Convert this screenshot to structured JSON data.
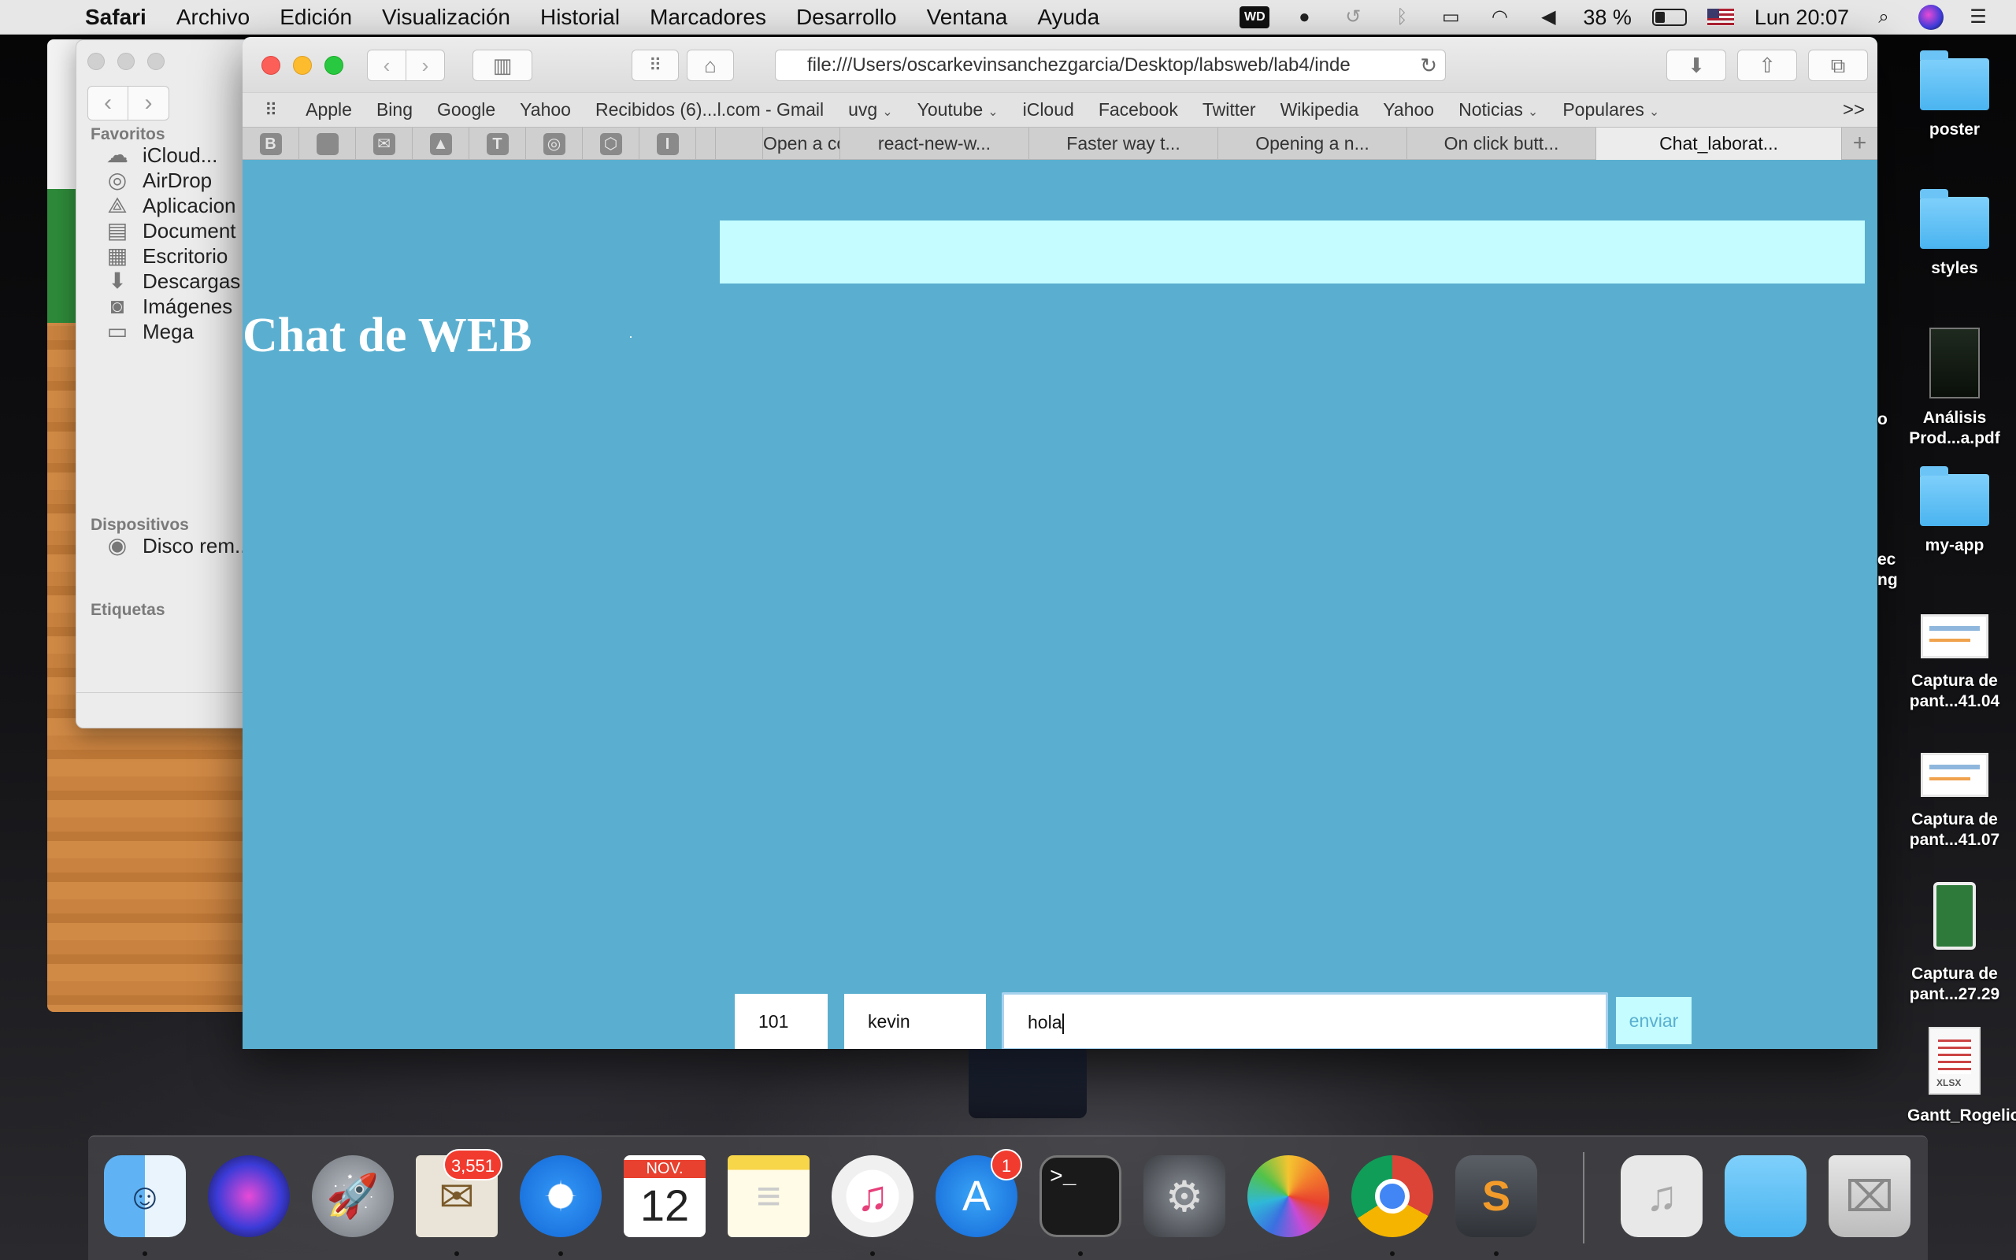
{
  "menubar": {
    "apple_icon": "apple-icon",
    "app_name": "Safari",
    "items": [
      "Archivo",
      "Edición",
      "Visualización",
      "Historial",
      "Marcadores",
      "Desarrollo",
      "Ventana",
      "Ayuda"
    ],
    "status": {
      "wd_label": "WD",
      "battery_percent": "38 %",
      "clock": "Lun 20:07"
    }
  },
  "finder": {
    "sections": {
      "favorites": "Favoritos",
      "devices": "Dispositivos",
      "tags": "Etiquetas"
    },
    "favorites": [
      {
        "label": "iCloud...",
        "icon": "cloud-icon"
      },
      {
        "label": "AirDrop",
        "icon": "airdrop-icon"
      },
      {
        "label": "Aplicacion",
        "icon": "applications-icon"
      },
      {
        "label": "Document",
        "icon": "document-icon"
      },
      {
        "label": "Escritorio",
        "icon": "desktop-icon"
      },
      {
        "label": "Descargas",
        "icon": "download-icon"
      },
      {
        "label": "Imágenes",
        "icon": "camera-icon"
      },
      {
        "label": "Mega",
        "icon": "folder-icon"
      }
    ],
    "devices": [
      {
        "label": "Disco rem...",
        "icon": "disc-icon"
      }
    ]
  },
  "safari": {
    "url": "file:///Users/oscarkevinsanchezgarcia/Desktop/labsweb/lab4/inde",
    "bookmarks": [
      {
        "label": "Apple",
        "dropdown": false
      },
      {
        "label": "Bing",
        "dropdown": false
      },
      {
        "label": "Google",
        "dropdown": false
      },
      {
        "label": "Yahoo",
        "dropdown": false
      },
      {
        "label": "Recibidos (6)...l.com - Gmail",
        "dropdown": false
      },
      {
        "label": "uvg",
        "dropdown": true
      },
      {
        "label": "Youtube",
        "dropdown": true
      },
      {
        "label": "iCloud",
        "dropdown": false
      },
      {
        "label": "Facebook",
        "dropdown": false
      },
      {
        "label": "Twitter",
        "dropdown": false
      },
      {
        "label": "Wikipedia",
        "dropdown": false
      },
      {
        "label": "Yahoo",
        "dropdown": false
      },
      {
        "label": "Noticias",
        "dropdown": true
      },
      {
        "label": "Populares",
        "dropdown": true
      }
    ],
    "bookmarks_more": ">>",
    "pinned_tabs": [
      {
        "glyph": "B",
        "icon": "bootstrap-icon"
      },
      {
        "glyph": "",
        "icon": "apple-icon"
      },
      {
        "glyph": "✉",
        "icon": "mail-icon"
      },
      {
        "glyph": "▲",
        "icon": "drive-icon"
      },
      {
        "glyph": "T",
        "icon": "t-icon"
      },
      {
        "glyph": "◎",
        "icon": "github-icon"
      },
      {
        "glyph": "⬡",
        "icon": "codepen-icon"
      },
      {
        "glyph": "I",
        "icon": "i-icon"
      }
    ],
    "tabs": [
      {
        "label": "",
        "active": false
      },
      {
        "label": "Open a com",
        "active": false
      },
      {
        "label": "react-new-w...",
        "active": false
      },
      {
        "label": "Faster way t...",
        "active": false
      },
      {
        "label": "Opening a n...",
        "active": false
      },
      {
        "label": "On click butt...",
        "active": false
      },
      {
        "label": "Chat_laborat...",
        "active": true
      }
    ]
  },
  "page": {
    "title": "Chat de WEB",
    "room_value": "101",
    "user_value": "kevin",
    "message_value": "hola",
    "send_label": "enviar",
    "colors": {
      "background": "#5aafd0",
      "message_area": "#c4fcff",
      "send_text": "#5aafd0"
    }
  },
  "desktop_items": [
    {
      "label": "poster",
      "kind": "folder"
    },
    {
      "label": "styles",
      "kind": "folder"
    },
    {
      "label": "Análisis Prod...a.pdf",
      "kind": "pdf"
    },
    {
      "label": "my-app",
      "kind": "folder"
    },
    {
      "label": "Captura de pant...41.04",
      "kind": "screenshot"
    },
    {
      "label": "Captura de pant...41.07",
      "kind": "screenshot"
    },
    {
      "label": "Captura de pant...27.29",
      "kind": "phone-screenshot"
    },
    {
      "label": "Gantt_Rogelio",
      "kind": "xlsx"
    }
  ],
  "desktop_partial_labels": [
    "o",
    "ec",
    "ng"
  ],
  "dock": {
    "apps": [
      {
        "name": "Finder",
        "icon": "finder-icon",
        "running": true
      },
      {
        "name": "Siri",
        "icon": "siri-icon",
        "running": false
      },
      {
        "name": "Launchpad",
        "icon": "launchpad-icon",
        "running": false
      },
      {
        "name": "Mail",
        "icon": "mail-stamp-icon",
        "running": true,
        "badge": "3,551"
      },
      {
        "name": "Safari",
        "icon": "safari-compass-icon",
        "running": true
      },
      {
        "name": "Calendar",
        "icon": "calendar-icon",
        "running": false,
        "month": "NOV.",
        "day": "12"
      },
      {
        "name": "Notes",
        "icon": "notes-icon",
        "running": false
      },
      {
        "name": "iTunes",
        "icon": "itunes-icon",
        "running": true
      },
      {
        "name": "App Store",
        "icon": "app-store-icon",
        "running": false,
        "badge": "1"
      },
      {
        "name": "Terminal",
        "icon": "terminal-icon",
        "running": true,
        "glyph": ">_"
      },
      {
        "name": "System Preferences",
        "icon": "gear-icon",
        "running": false
      },
      {
        "name": "Photos",
        "icon": "photos-icon",
        "running": false
      },
      {
        "name": "Chrome",
        "icon": "chrome-icon",
        "running": true
      },
      {
        "name": "Sublime Text",
        "icon": "sublime-icon",
        "running": true,
        "glyph": "S"
      }
    ],
    "extras": [
      {
        "name": "Music folder",
        "icon": "music-folder-icon"
      },
      {
        "name": "Folder",
        "icon": "folder-icon"
      },
      {
        "name": "Trash",
        "icon": "trash-icon"
      }
    ]
  }
}
